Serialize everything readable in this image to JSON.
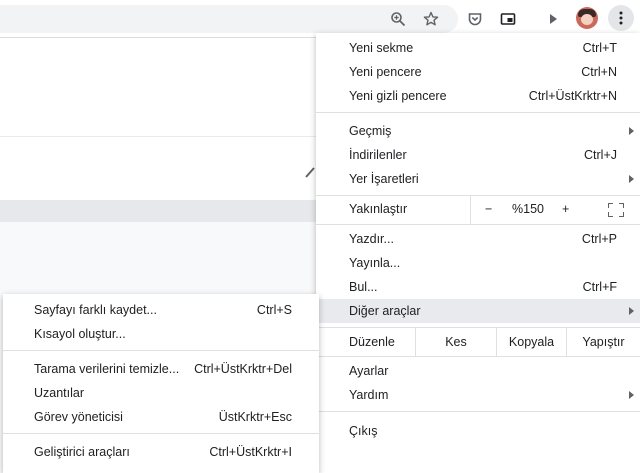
{
  "toolbar": {
    "icons": [
      "zoom-icon",
      "bookmark-star-icon",
      "pocket-icon",
      "picture-in-picture-icon",
      "media-play-icon",
      "profile-avatar",
      "more-menu-icon"
    ]
  },
  "menu": {
    "new_tab": {
      "label": "Yeni sekme",
      "shortcut": "Ctrl+T"
    },
    "new_window": {
      "label": "Yeni pencere",
      "shortcut": "Ctrl+N"
    },
    "new_incognito": {
      "label": "Yeni gizli pencere",
      "shortcut": "Ctrl+ÜstKrktr+N"
    },
    "history": {
      "label": "Geçmiş"
    },
    "downloads": {
      "label": "İndirilenler",
      "shortcut": "Ctrl+J"
    },
    "bookmarks": {
      "label": "Yer İşaretleri"
    },
    "zoom": {
      "label": "Yakınlaştır",
      "minus": "−",
      "value": "%150",
      "plus": "+"
    },
    "print": {
      "label": "Yazdır...",
      "shortcut": "Ctrl+P"
    },
    "cast": {
      "label": "Yayınla..."
    },
    "find": {
      "label": "Bul...",
      "shortcut": "Ctrl+F"
    },
    "more_tools": {
      "label": "Diğer araçlar"
    },
    "edit": {
      "label": "Düzenle",
      "cut": "Kes",
      "copy": "Kopyala",
      "paste": "Yapıştır"
    },
    "settings": {
      "label": "Ayarlar"
    },
    "help": {
      "label": "Yardım"
    },
    "exit": {
      "label": "Çıkış"
    }
  },
  "submenu": {
    "save_page": {
      "label": "Sayfayı farklı kaydet...",
      "shortcut": "Ctrl+S"
    },
    "create_shortcut": {
      "label": "Kısayol oluştur..."
    },
    "clear_data": {
      "label": "Tarama verilerini temizle...",
      "shortcut": "Ctrl+ÜstKrktr+Del"
    },
    "extensions": {
      "label": "Uzantılar"
    },
    "task_manager": {
      "label": "Görev yöneticisi",
      "shortcut": "ÜstKrktr+Esc"
    },
    "dev_tools": {
      "label": "Geliştirici araçları",
      "shortcut": "Ctrl+ÜstKrktr+I"
    }
  }
}
